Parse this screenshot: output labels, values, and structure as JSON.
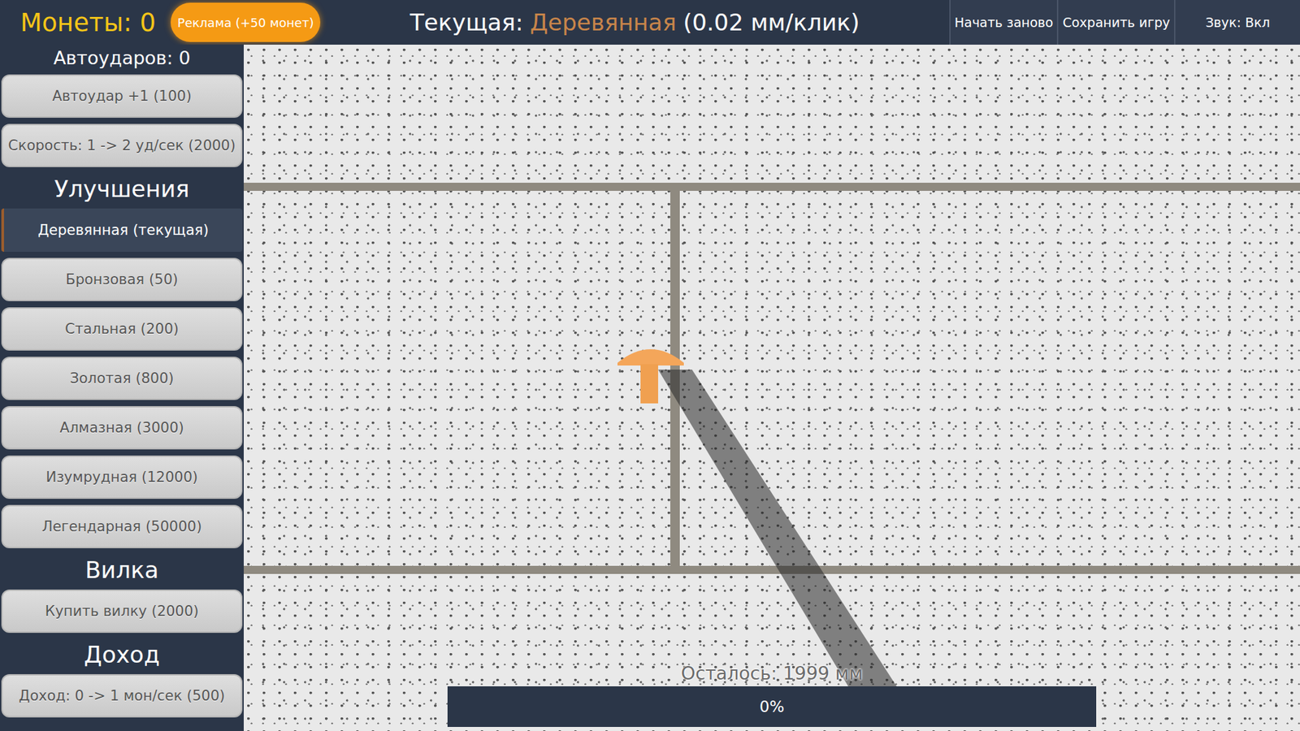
{
  "top_bar": {
    "coins": "Монеты: 0",
    "ad_button": "Реклама (+50 монет)",
    "current": {
      "prefix": "Текущая:",
      "tier": "Деревянная",
      "rate": "(0.02 мм/клик)"
    },
    "buttons": [
      "Начать заново",
      "Сохранить игру",
      "Звук: Вкл"
    ]
  },
  "sidebar": {
    "autostrikes": "Автоударов: 0",
    "autostrike_buttons": [
      "Автоудар +1 (100)",
      "Скорость: 1 -> 2 уд/сек (2000)"
    ],
    "sections": [
      {
        "title": "Улучшения",
        "items": [
          {
            "label": "Деревянная (текущая)",
            "selected": true
          },
          {
            "label": "Бронзовая (50)",
            "selected": false
          },
          {
            "label": "Стальная (200)",
            "selected": false
          },
          {
            "label": "Золотая (800)",
            "selected": false
          },
          {
            "label": "Алмазная (3000)",
            "selected": false
          },
          {
            "label": "Изумрудная (12000)",
            "selected": false
          },
          {
            "label": "Легендарная (50000)",
            "selected": false
          }
        ]
      },
      {
        "title": "Вилка",
        "items": [
          {
            "label": "Купить вилку (2000)",
            "selected": false
          }
        ]
      },
      {
        "title": "Доход",
        "items": [
          {
            "label": "Доход: 0 -> 1 мон/сек (500)",
            "selected": false
          }
        ]
      }
    ]
  },
  "game": {
    "remaining": "Осталось: 1999 мм",
    "progress": {
      "text": "0%",
      "level": 0
    }
  }
}
